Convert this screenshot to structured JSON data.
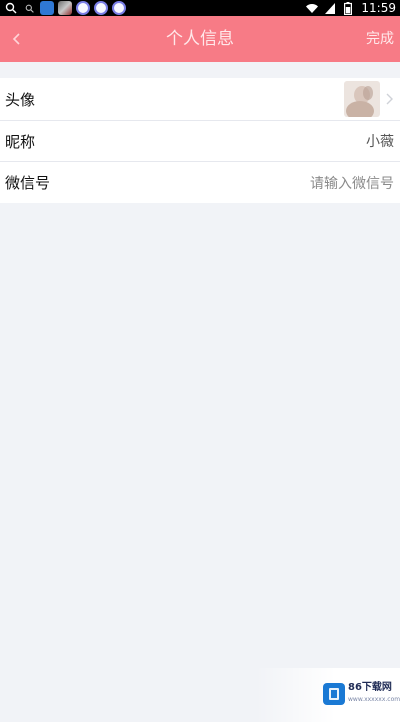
{
  "status_bar": {
    "time": "11:59",
    "icons": [
      "search-icon",
      "search-small-icon",
      "app-icon-blue",
      "app-icon-mixed",
      "flower-icon",
      "flower-icon",
      "flower-icon"
    ],
    "right_icons": [
      "wifi-icon",
      "signal-icon",
      "battery-icon"
    ]
  },
  "header": {
    "title": "个人信息",
    "done_label": "完成",
    "background": "#f77b86"
  },
  "profile": {
    "rows": [
      {
        "label": "头像",
        "type": "avatar"
      },
      {
        "label": "昵称",
        "value": "小薇"
      },
      {
        "label": "微信号",
        "placeholder": "请输入微信号"
      }
    ]
  },
  "watermark": {
    "logo_text": "86下载网",
    "subtext": "www.xxxxxx.com"
  }
}
